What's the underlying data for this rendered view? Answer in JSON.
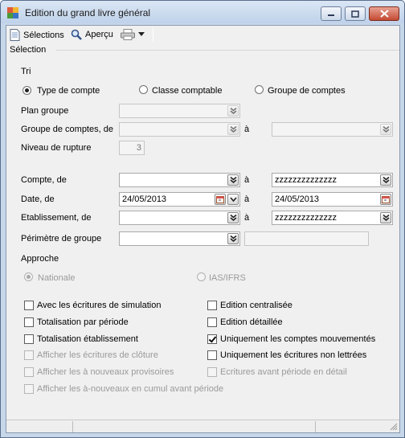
{
  "window": {
    "title": "Edition du grand livre général"
  },
  "toolbar": {
    "selections_label": "Sélections",
    "apercu_label": "Aperçu"
  },
  "group": {
    "label": "Sélection"
  },
  "tri": {
    "label": "Tri",
    "options": [
      {
        "label": "Type de compte",
        "selected": true
      },
      {
        "label": "Classe comptable",
        "selected": false
      },
      {
        "label": "Groupe de comptes",
        "selected": false
      }
    ]
  },
  "fields": {
    "plan_groupe": {
      "label": "Plan groupe",
      "value": ""
    },
    "groupe_comptes": {
      "label": "Groupe de comptes, de",
      "from": "",
      "to": "",
      "a_label": "à"
    },
    "niveau_rupture": {
      "label": "Niveau de rupture",
      "value": "3"
    },
    "compte": {
      "label": "Compte, de",
      "from": "",
      "to": "zzzzzzzzzzzzzz",
      "a_label": "à"
    },
    "date": {
      "label": "Date, de",
      "from": "24/05/2013",
      "to": "24/05/2013",
      "a_label": "à"
    },
    "etablissement": {
      "label": "Etablissement, de",
      "from": "",
      "to": "zzzzzzzzzzzzzz",
      "a_label": "à"
    },
    "perimetre": {
      "label": "Périmètre de groupe",
      "value": ""
    }
  },
  "approche": {
    "label": "Approche",
    "options": [
      {
        "label": "Nationale",
        "selected": true
      },
      {
        "label": "IAS/IFRS",
        "selected": false
      }
    ]
  },
  "checkboxes_left": [
    {
      "label": "Avec les écritures de simulation",
      "checked": false,
      "enabled": true
    },
    {
      "label": "Totalisation par période",
      "checked": false,
      "enabled": true
    },
    {
      "label": "Totalisation établissement",
      "checked": false,
      "enabled": true
    },
    {
      "label": "Afficher les écritures de clôture",
      "checked": false,
      "enabled": false
    },
    {
      "label": "Afficher les à nouveaux provisoires",
      "checked": false,
      "enabled": false
    },
    {
      "label": "Afficher les à-nouveaux en cumul avant période",
      "checked": false,
      "enabled": false
    }
  ],
  "checkboxes_right": [
    {
      "label": "Edition centralisée",
      "checked": false,
      "enabled": true
    },
    {
      "label": "Edition détaillée",
      "checked": false,
      "enabled": true
    },
    {
      "label": "Uniquement les comptes mouvementés",
      "checked": true,
      "enabled": true
    },
    {
      "label": "Uniquement les écritures non lettrées",
      "checked": false,
      "enabled": true
    },
    {
      "label": "Ecritures avant période en détail",
      "checked": false,
      "enabled": false
    }
  ]
}
